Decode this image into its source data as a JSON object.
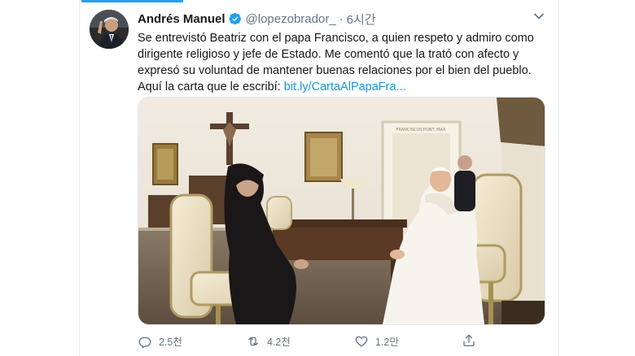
{
  "tweet": {
    "author_name": "Andrés Manuel",
    "handle": "@lopezobrador_",
    "separator": "·",
    "time": "6시간",
    "body_text": "Se entrevistó Beatriz con el papa Francisco, a quien respeto y admiro como dirigente religioso y jefe de Estado. Me comentó que la trató con afecto y expresó su voluntad de mantener buenas relaciones por el bien del pueblo. Aquí la carta que le escribí: ",
    "link_text": "bit.ly/CartaAlPapaFra...",
    "wall_inscription": "FRANCISCUS PONT. MAX",
    "actions": {
      "reply_count": "2.5천",
      "retweet_count": "4.2천",
      "like_count": "1.2만"
    }
  },
  "icons": [
    "verified-badge-icon",
    "chevron-down-icon",
    "reply-icon",
    "retweet-icon",
    "like-icon",
    "share-icon"
  ],
  "colors": {
    "accent": "#1da1f2",
    "link": "#1b95e0",
    "muted": "#657786"
  }
}
